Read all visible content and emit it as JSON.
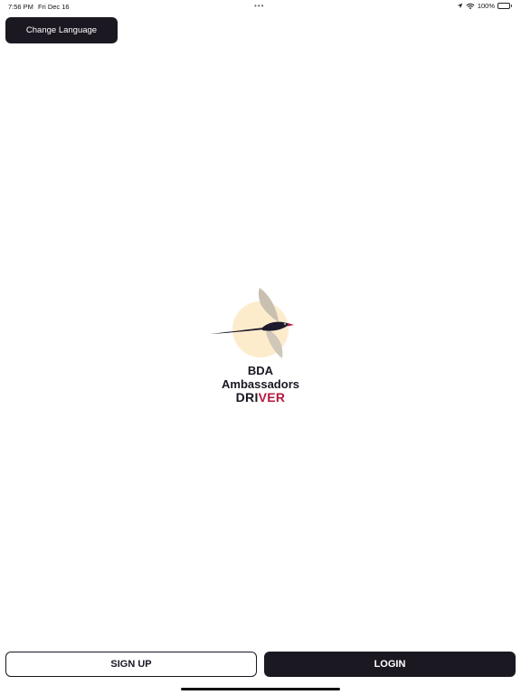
{
  "status_bar": {
    "time": "7:56 PM",
    "date": "Fri Dec 16",
    "dots": "•••",
    "battery_text": "100%",
    "icons": [
      "location-arrow-icon",
      "wifi-icon",
      "battery-icon"
    ]
  },
  "header": {
    "change_language_label": "Change Language"
  },
  "logo": {
    "line1": "BDA",
    "line2": "Ambassadors",
    "driver_dark_part": "DRI",
    "driver_red_part": "VER",
    "colors": {
      "sun": "#fdeccc",
      "bird": "#1d1a2c",
      "wing": "#c9c0b0",
      "accent_red": "#b6193e"
    }
  },
  "actions": {
    "sign_up_label": "SIGN UP",
    "login_label": "LOGIN"
  },
  "colors": {
    "primary_dark": "#1b1822",
    "background": "#ffffff"
  }
}
